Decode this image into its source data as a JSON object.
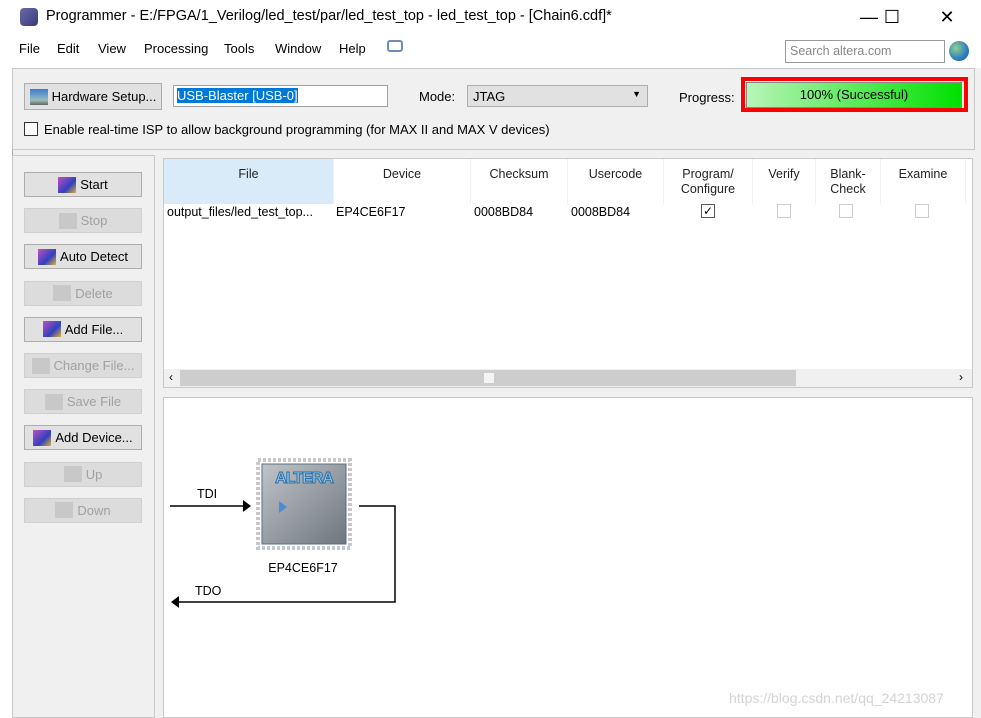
{
  "window": {
    "title": "Programmer - E:/FPGA/1_Verilog/led_test/par/led_test_top - led_test_top - [Chain6.cdf]*",
    "minimize": "—",
    "maximize": "☐",
    "close": "✕"
  },
  "menu": {
    "items": [
      "File",
      "Edit",
      "View",
      "Processing",
      "Tools",
      "Window",
      "Help"
    ],
    "search_placeholder": "Search altera.com"
  },
  "toolbar": {
    "hardware_setup": "Hardware Setup...",
    "hardware_value": "USB-Blaster [USB-0]",
    "mode_label": "Mode:",
    "mode_value": "JTAG",
    "progress_label": "Progress:",
    "progress_text": "100% (Successful)",
    "progress_percent": 100,
    "progress_color": "#00e000",
    "highlight_color": "#ff0000",
    "isp_label": "Enable real-time ISP to allow background programming (for MAX II and MAX V devices)",
    "isp_checked": false
  },
  "side_buttons": [
    {
      "label": "Start",
      "enabled": true
    },
    {
      "label": "Stop",
      "enabled": false
    },
    {
      "label": "Auto Detect",
      "enabled": true
    },
    {
      "label": "Delete",
      "enabled": false
    },
    {
      "label": "Add File...",
      "enabled": true
    },
    {
      "label": "Change File...",
      "enabled": false
    },
    {
      "label": "Save File",
      "enabled": false
    },
    {
      "label": "Add Device...",
      "enabled": true
    },
    {
      "label": "Up",
      "enabled": false
    },
    {
      "label": "Down",
      "enabled": false
    }
  ],
  "table": {
    "headers": [
      "File",
      "Device",
      "Checksum",
      "Usercode",
      "Program/\nConfigure",
      "Verify",
      "Blank-\nCheck",
      "Examine"
    ],
    "rows": [
      {
        "file": "output_files/led_test_top...",
        "device": "EP4CE6F17",
        "checksum": "0008BD84",
        "usercode": "0008BD84",
        "program": true,
        "verify": false,
        "blank_check": false,
        "examine": false
      }
    ]
  },
  "chain": {
    "tdi": "TDI",
    "tdo": "TDO",
    "device": "EP4CE6F17",
    "logo": "ALTERA"
  },
  "watermark": "https://blog.csdn.net/qq_24213087"
}
